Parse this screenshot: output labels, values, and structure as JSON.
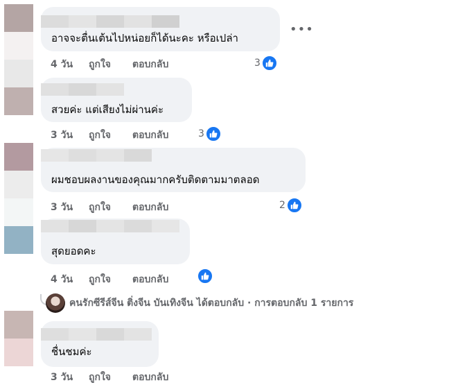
{
  "comments": [
    {
      "text": "อาจจะตื่นเต้นไปหน่อยก็ได้นะคะ หรือเปล่า",
      "time": "4 วัน",
      "like_label": "ถูกใจ",
      "reply_label": "ตอบกลับ",
      "reaction_count": "3"
    },
    {
      "text": "สวยค่ะ แต่เสียงไม่ผ่านค่ะ",
      "time": "3 วัน",
      "like_label": "ถูกใจ",
      "reply_label": "ตอบกลับ",
      "reaction_count": "3"
    },
    {
      "text": "ผมชอบผลงานของคุณมากครับติดตามมาตลอด",
      "time": "3 วัน",
      "like_label": "ถูกใจ",
      "reply_label": "ตอบกลับ",
      "reaction_count": "2"
    },
    {
      "text": "สุดยอดคะ",
      "time": "4 วัน",
      "like_label": "ถูกใจ",
      "reply_label": "ตอบกลับ",
      "reaction_count": ""
    },
    {
      "text": "ชื่นชมค่ะ",
      "time": "3 วัน",
      "like_label": "ถูกใจ",
      "reply_label": "ตอบกลับ",
      "reaction_count": ""
    }
  ],
  "reply_summary": {
    "text": "คนรักซีรีส์จีน ติ่งจีน บันเทิงจีน ได้ตอบกลับ · การตอบกลับ 1 รายการ"
  },
  "more_icon": "more-options-icon",
  "like_icon": "thumbs-up-icon",
  "colors": {
    "bubble": "#f0f2f5",
    "meta": "#65676b",
    "like_blue": "#1877f2"
  }
}
